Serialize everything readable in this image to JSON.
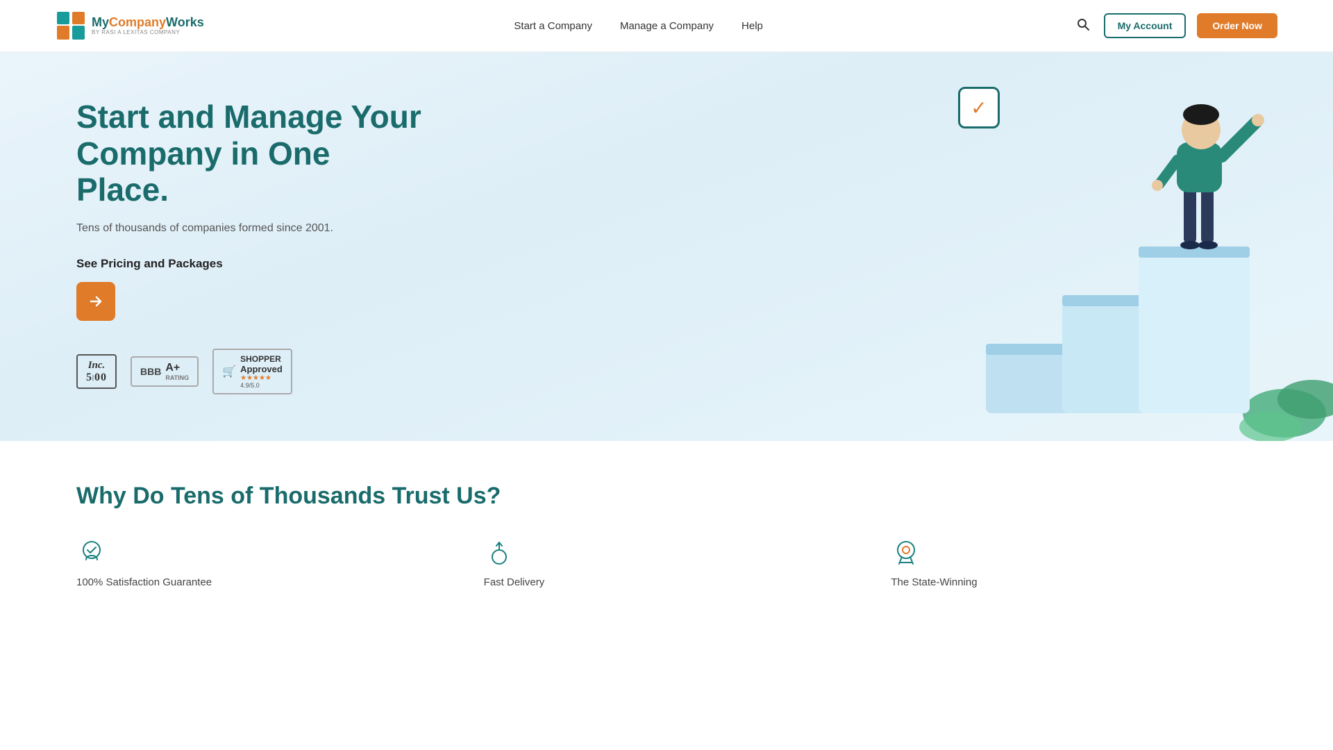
{
  "navbar": {
    "logo_main": "MyCompanyWorks",
    "logo_main_highlight": "Works",
    "logo_sub": "BY RASI A LEXITAS COMPANY",
    "nav_links": [
      {
        "label": "Start a Company",
        "id": "start-company"
      },
      {
        "label": "Manage a Company",
        "id": "manage-company"
      },
      {
        "label": "Help",
        "id": "help"
      }
    ],
    "my_account_label": "My Account",
    "order_now_label": "Order Now"
  },
  "hero": {
    "title_line1": "Start and Manage Your",
    "title_line2": "Company in One Place.",
    "subtitle": "Tens of thousands of companies formed since 2001.",
    "cta_label": "See Pricing and Packages",
    "arrow_label": "→"
  },
  "badges": {
    "inc": {
      "top": "Inc.",
      "bottom": "5|00"
    },
    "bbb": {
      "label": "BBB",
      "rating": "A+",
      "sublabel": "RATING"
    },
    "shopper": {
      "label": "SHOPPER",
      "approved": "Approved",
      "stars": "★★★★★",
      "score": "4.9/5.0"
    }
  },
  "why_section": {
    "title": "Why Do Tens of Thousands Trust Us?",
    "cards": [
      {
        "icon": "check-badge",
        "label": "100% Satisfaction Guarantee"
      },
      {
        "icon": "upload",
        "label": "Fast Delivery"
      },
      {
        "icon": "award",
        "label": "The State-Winning"
      }
    ]
  }
}
